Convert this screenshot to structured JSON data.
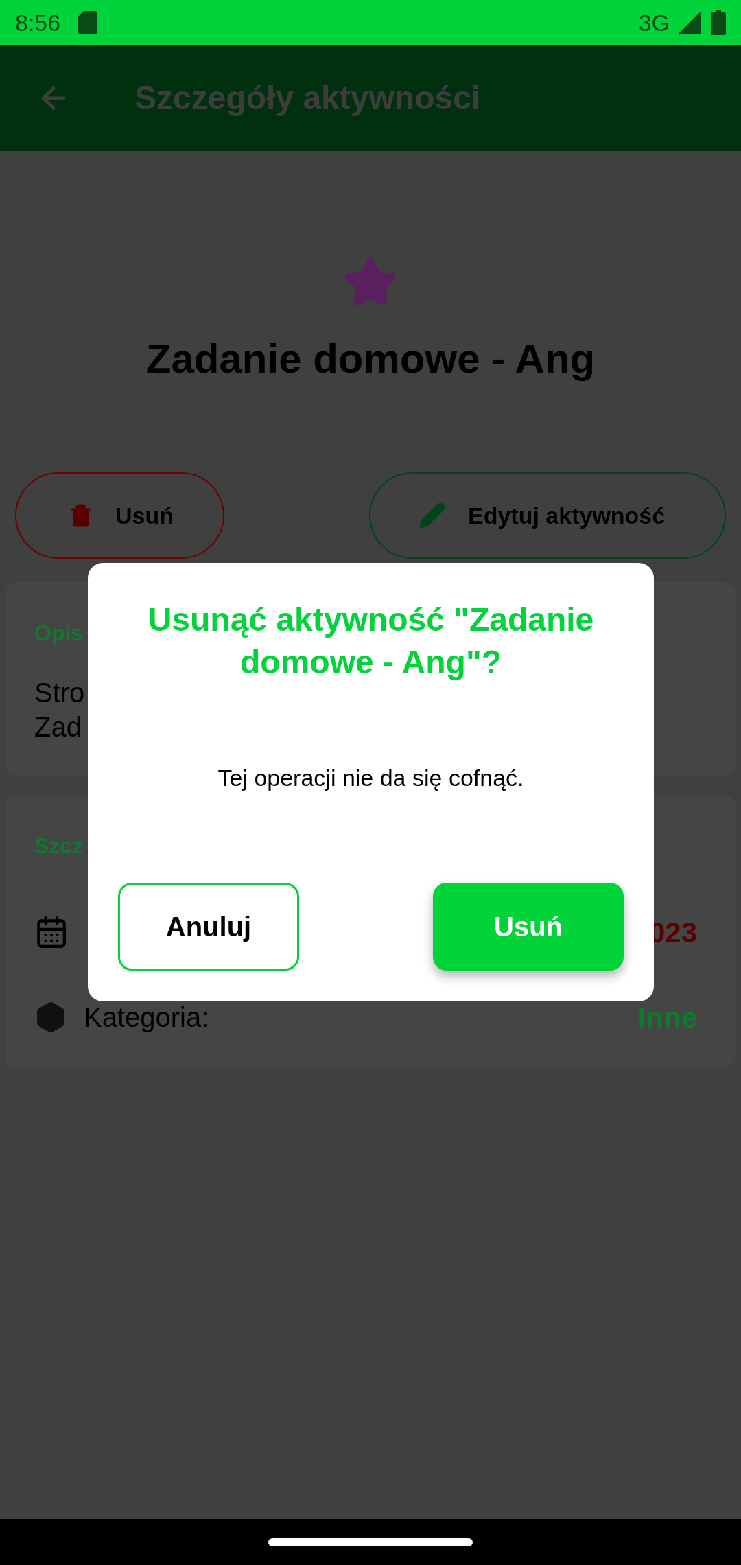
{
  "status_bar": {
    "time": "8:56",
    "network": "3G"
  },
  "app_bar": {
    "title": "Szczegóły aktywności"
  },
  "activity": {
    "title": "Zadanie domowe - Ang"
  },
  "actions": [
    {
      "kind": "delete",
      "label": "Usuń"
    },
    {
      "kind": "edit",
      "label": "Edytuj aktywność"
    }
  ],
  "description_card": {
    "heading": "Opis",
    "lines": [
      "Stro",
      "Zad"
    ]
  },
  "details_card": {
    "heading": "Szcz",
    "rows": [
      {
        "kind": "date",
        "value": "023"
      },
      {
        "kind": "category",
        "label": "Kategoria:",
        "value": "Inne"
      }
    ]
  },
  "dialog": {
    "title": "Usunąć aktywność \"Zadanie domowe - Ang\"?",
    "message": "Tej operacji nie da się cofnąć.",
    "buttons": [
      {
        "kind": "cancel",
        "label": "Anuluj"
      },
      {
        "kind": "confirm",
        "label": "Usuń"
      }
    ]
  }
}
